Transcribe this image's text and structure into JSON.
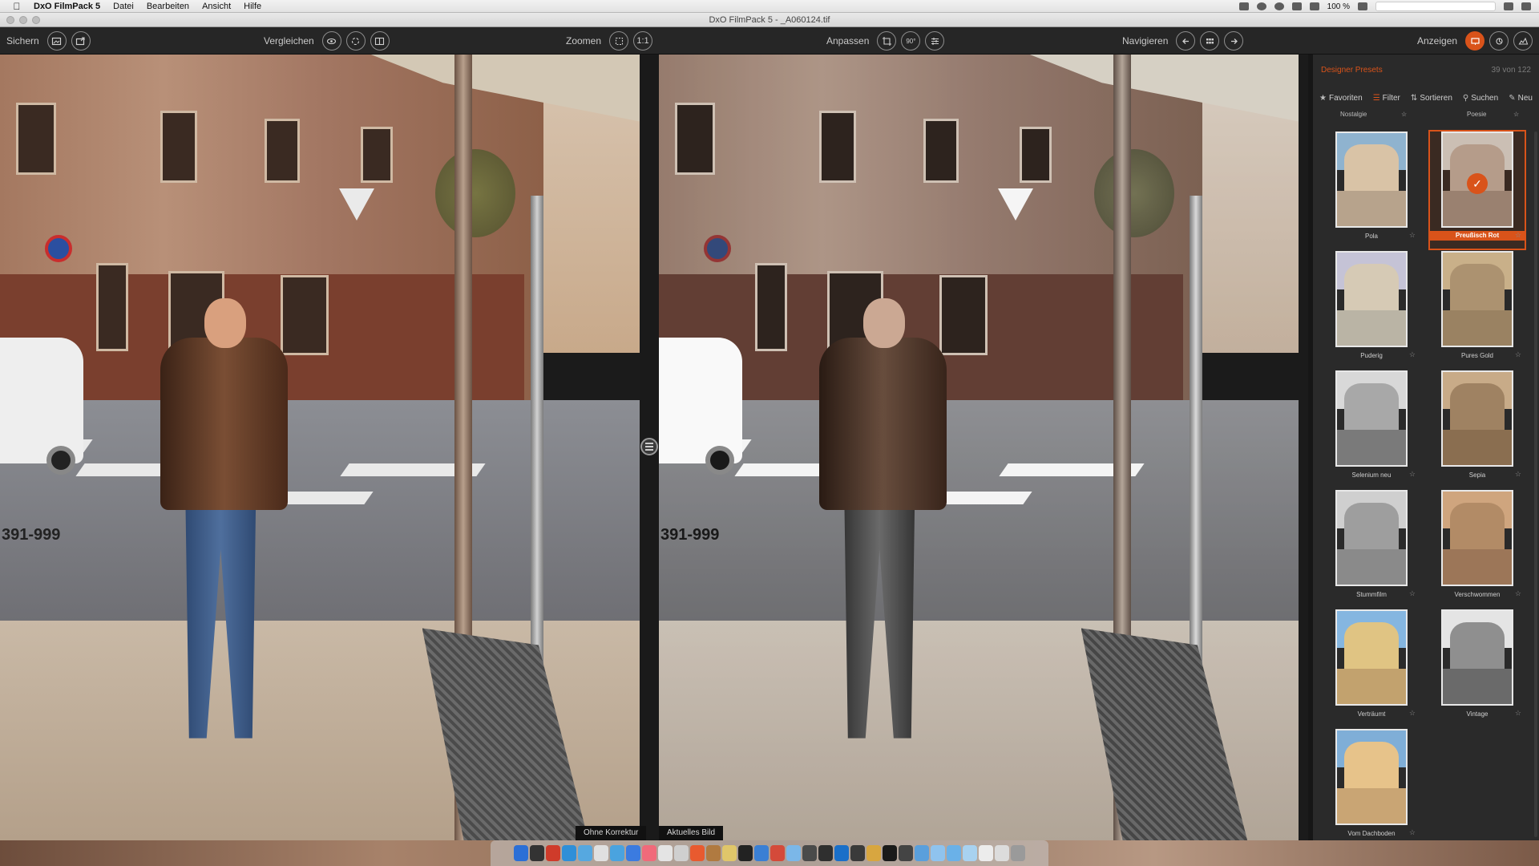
{
  "menubar": {
    "app_name": "DxO FilmPack 5",
    "items": [
      "Datei",
      "Bearbeiten",
      "Ansicht",
      "Hilfe"
    ],
    "battery": "100 %"
  },
  "window": {
    "title": "DxO FilmPack 5 - _A060124.tif"
  },
  "toolbar": {
    "save_label": "Sichern",
    "compare_label": "Vergleichen",
    "zoom_label": "Zoomen",
    "zoom_one_to_one": "1:1",
    "adjust_label": "Anpassen",
    "rotate_label": "90°",
    "navigate_label": "Navigieren",
    "view_label": "Anzeigen"
  },
  "panes": {
    "left_caption": "Ohne Korrektur",
    "right_caption": "Aktuelles Bild",
    "plate_text": "391-999"
  },
  "sidebar": {
    "title": "Designer Presets",
    "count": "39 von 122",
    "tools": [
      "Favoriten",
      "Filter",
      "Sortieren",
      "Suchen",
      "Neu"
    ],
    "top_labels": [
      "Nostalgie",
      "Poesie"
    ],
    "presets": [
      {
        "label": "Pola",
        "sky": "#8fb3cf",
        "bld": "#d9c3a6",
        "gnd": "#b7a38c",
        "selected": false
      },
      {
        "label": "Preußisch Rot",
        "sky": "#cbbfb4",
        "bld": "#b59c8a",
        "gnd": "#9a8170",
        "selected": true
      },
      {
        "label": "Puderig",
        "sky": "#c5c3d6",
        "bld": "#d6cab5",
        "gnd": "#bab4a5",
        "selected": false
      },
      {
        "label": "Pures Gold",
        "sky": "#c9b089",
        "bld": "#ac9270",
        "gnd": "#9a8262",
        "selected": false
      },
      {
        "label": "Selenium neu",
        "sky": "#d8d8d8",
        "bld": "#a8a8a8",
        "gnd": "#7a7a7a",
        "selected": false
      },
      {
        "label": "Sepia",
        "sky": "#c8ab88",
        "bld": "#9f8262",
        "gnd": "#8a6e50",
        "selected": false
      },
      {
        "label": "Stummfilm",
        "sky": "#cfcfcf",
        "bld": "#9e9e9e",
        "gnd": "#8a8a8a",
        "selected": false
      },
      {
        "label": "Verschwommen",
        "sky": "#cfa57e",
        "bld": "#b28b66",
        "gnd": "#9c7658",
        "selected": false
      },
      {
        "label": "Verträumt",
        "sky": "#85b6e0",
        "bld": "#e0c483",
        "gnd": "#c2a26e",
        "selected": false
      },
      {
        "label": "Vintage",
        "sky": "#e4e4e4",
        "bld": "#8f8f8f",
        "gnd": "#6a6a6a",
        "selected": false
      },
      {
        "label": "Vom Dachboden",
        "sky": "#7faed7",
        "bld": "#e7c38a",
        "gnd": "#c9a574",
        "selected": false
      }
    ]
  },
  "colors": {
    "accent": "#d9531a"
  },
  "dock": {
    "icon_colors": [
      "#2b6fd6",
      "#333333",
      "#cf3b2a",
      "#2f8fd8",
      "#56a8e0",
      "#e0e0e0",
      "#4aa3df",
      "#3b7be0",
      "#f06a7a",
      "#e4e4e4",
      "#cfcfcf",
      "#e85a2f",
      "#b07a40",
      "#e0c66a",
      "#222222",
      "#3a7fd4",
      "#d44a3a",
      "#7bb7e8",
      "#4a4a4a",
      "#2f2f2f",
      "#1a6fc9",
      "#3a3a3a",
      "#d8a640",
      "#1a1a1a",
      "#444444",
      "#5a9fdc",
      "#8fc3ee",
      "#6ab1e8",
      "#a8d2f0",
      "#ececec",
      "#dcdcdc",
      "#9a9a9a"
    ]
  }
}
